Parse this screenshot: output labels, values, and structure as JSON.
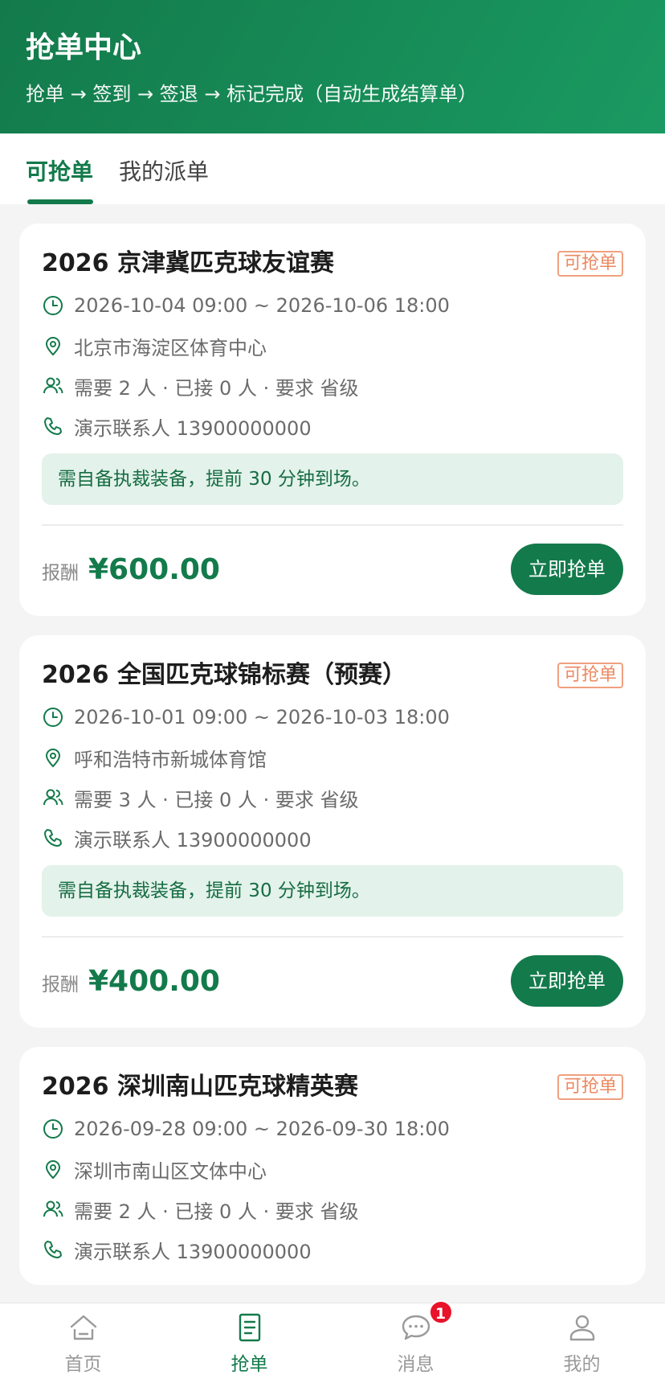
{
  "header": {
    "title": "抢单中心",
    "subtitle": "抢单 → 签到 → 签退 → 标记完成（自动生成结算单）"
  },
  "tabs": [
    {
      "label": "可抢单",
      "active": true
    },
    {
      "label": "我的派单",
      "active": false
    }
  ],
  "orders": [
    {
      "title": "2026 京津冀匹克球友谊赛",
      "status": "可抢单",
      "time": "2026-10-04 09:00 ~ 2026-10-06 18:00",
      "location": "北京市海淀区体育中心",
      "people": "需要 2 人 · 已接 0 人 · 要求 省级",
      "contact": "演示联系人 13900000000",
      "note": "需自备执裁装备，提前 30 分钟到场。",
      "price_label": "报酬",
      "price": "¥600.00",
      "button": "立即抢单"
    },
    {
      "title": "2026 全国匹克球锦标赛（预赛）",
      "status": "可抢单",
      "time": "2026-10-01 09:00 ~ 2026-10-03 18:00",
      "location": "呼和浩特市新城体育馆",
      "people": "需要 3 人 · 已接 0 人 · 要求 省级",
      "contact": "演示联系人 13900000000",
      "note": "需自备执裁装备，提前 30 分钟到场。",
      "price_label": "报酬",
      "price": "¥400.00",
      "button": "立即抢单"
    },
    {
      "title": "2026 深圳南山匹克球精英赛",
      "status": "可抢单",
      "time": "2026-09-28 09:00 ~ 2026-09-30 18:00",
      "location": "深圳市南山区文体中心",
      "people": "需要 2 人 · 已接 0 人 · 要求 省级",
      "contact": "演示联系人 13900000000"
    }
  ],
  "icons": {
    "time": "clock-icon",
    "location": "location-pin-icon",
    "people": "people-icon",
    "contact": "phone-icon"
  },
  "nav": [
    {
      "label": "首页",
      "icon": "home-icon",
      "active": false
    },
    {
      "label": "抢单",
      "icon": "document-icon",
      "active": true
    },
    {
      "label": "消息",
      "icon": "chat-icon",
      "active": false,
      "badge": "1"
    },
    {
      "label": "我的",
      "icon": "user-icon",
      "active": false
    }
  ],
  "colors": {
    "primary": "#137a4b",
    "status": "#ec8a62",
    "note_bg": "#e3f2ea",
    "badge": "#e8132a"
  }
}
